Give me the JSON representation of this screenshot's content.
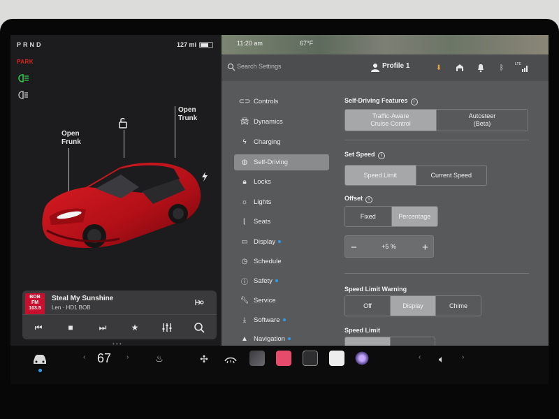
{
  "status": {
    "gear": "PRND",
    "park": "PARK",
    "range": "127 mi"
  },
  "car": {
    "frunk": [
      "Open",
      "Frunk"
    ],
    "trunk": [
      "Open",
      "Trunk"
    ]
  },
  "media": {
    "station_logo": [
      "BOB",
      "FM",
      "103.5"
    ],
    "song": "Steal My Sunshine",
    "station": "Len · HD1 BOB"
  },
  "map": {
    "time": "11:20 am",
    "temp": "67°F"
  },
  "topbar": {
    "search_placeholder": "Search Settings",
    "profile": "Profile 1",
    "signal": "LTE"
  },
  "menu": [
    {
      "label": "Controls",
      "icon": "toggle-icon",
      "dot": false
    },
    {
      "label": "Dynamics",
      "icon": "car-icon",
      "dot": false
    },
    {
      "label": "Charging",
      "icon": "bolt-icon",
      "dot": false
    },
    {
      "label": "Self-Driving",
      "icon": "steering-wheel-icon",
      "dot": false,
      "active": true
    },
    {
      "label": "Locks",
      "icon": "lock-icon",
      "dot": false
    },
    {
      "label": "Lights",
      "icon": "sun-icon",
      "dot": false
    },
    {
      "label": "Seats",
      "icon": "seat-icon",
      "dot": false
    },
    {
      "label": "Display",
      "icon": "display-icon",
      "dot": true
    },
    {
      "label": "Schedule",
      "icon": "clock-icon",
      "dot": false
    },
    {
      "label": "Safety",
      "icon": "safety-icon",
      "dot": true
    },
    {
      "label": "Service",
      "icon": "wrench-icon",
      "dot": false
    },
    {
      "label": "Software",
      "icon": "download-icon",
      "dot": true
    },
    {
      "label": "Navigation",
      "icon": "navigation-icon",
      "dot": true
    }
  ],
  "self_driving": {
    "features_title": "Self-Driving Features",
    "features": [
      [
        "Traffic-Aware",
        "Cruise Control"
      ],
      [
        "Autosteer",
        "(Beta)"
      ]
    ],
    "set_speed_title": "Set Speed",
    "set_speed": [
      "Speed Limit",
      "Current Speed"
    ],
    "offset_title": "Offset",
    "offset": [
      "Fixed",
      "Percentage"
    ],
    "offset_value": "+5 %",
    "warning_title": "Speed Limit Warning",
    "warning": [
      "Off",
      "Display",
      "Chime"
    ],
    "speed_limit_title": "Speed Limit"
  },
  "bottom": {
    "temperature": "67"
  },
  "colors": {
    "accent_blue": "#2e9cf0",
    "park_red": "#e0251b",
    "car_red": "#c0131b",
    "download_orange": "#e8a33a"
  }
}
